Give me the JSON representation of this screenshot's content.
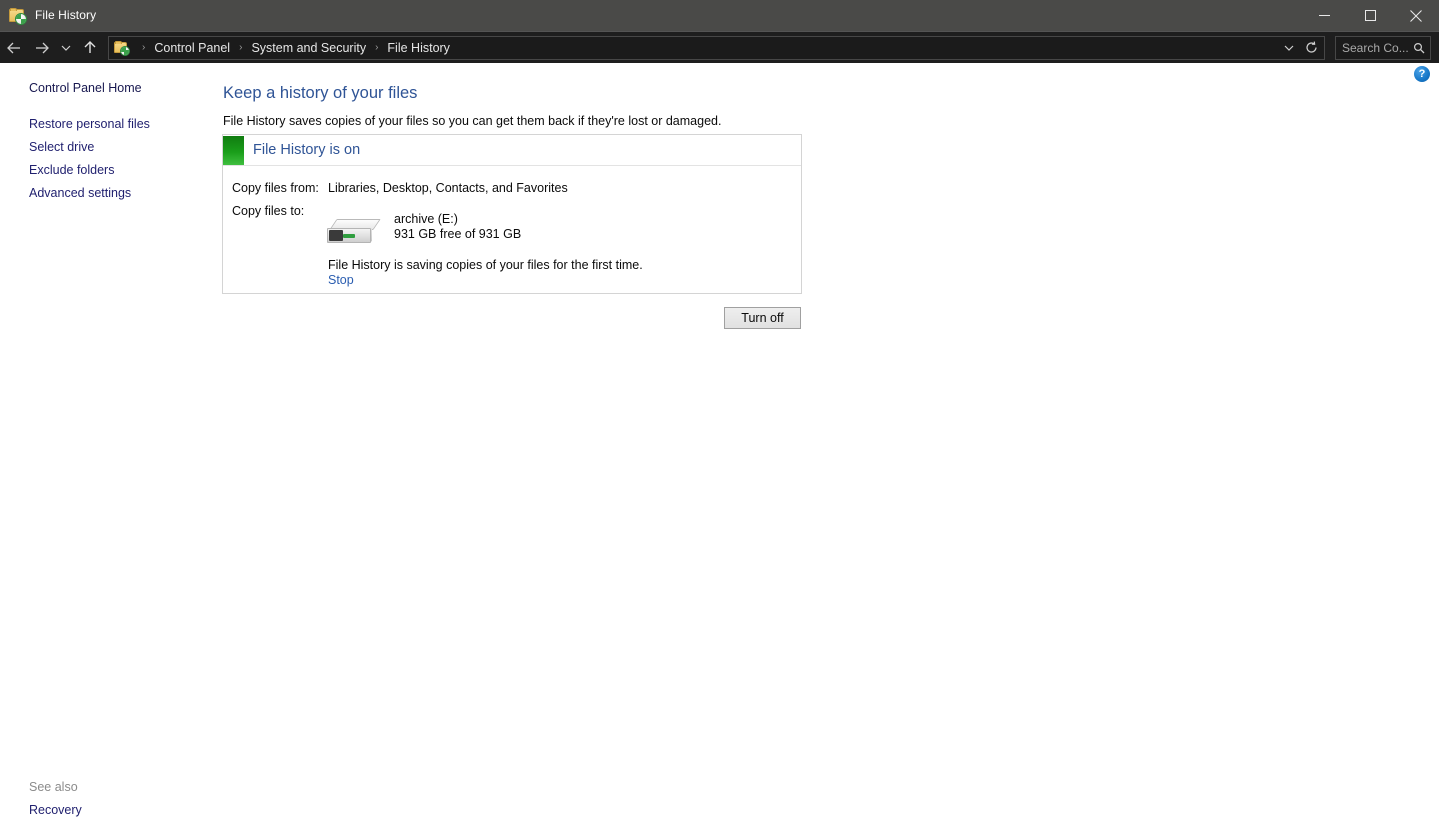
{
  "window": {
    "title": "File History",
    "icon": "file-history-icon",
    "controls": {
      "minimize": "minimize",
      "maximize": "maximize",
      "close": "close"
    }
  },
  "addressbar": {
    "back": "back",
    "forward": "forward",
    "recent": "recent-locations",
    "up": "up-one-level",
    "breadcrumbs": [
      {
        "label": "Control Panel"
      },
      {
        "label": "System and Security"
      },
      {
        "label": "File History"
      }
    ],
    "separator": "›",
    "dropdown": "previous-locations",
    "refresh": "refresh",
    "search": {
      "placeholder": "Search Co...",
      "value": ""
    }
  },
  "sidebar": {
    "home": "Control Panel Home",
    "items": [
      {
        "label": "Restore personal files"
      },
      {
        "label": "Select drive"
      },
      {
        "label": "Exclude folders"
      },
      {
        "label": "Advanced settings"
      }
    ],
    "see_also_heading": "See also",
    "see_also_items": [
      {
        "label": "Recovery"
      }
    ]
  },
  "main": {
    "title": "Keep a history of your files",
    "subtitle": "File History saves copies of your files so you can get them back if they're lost or damaged.",
    "status": {
      "headline": "File History is on",
      "chip_color": "#1a9e1a"
    },
    "copy_from": {
      "label": "Copy files from:",
      "value": "Libraries, Desktop, Contacts, and Favorites"
    },
    "copy_to": {
      "label": "Copy files to:",
      "drive_name": "archive (E:)",
      "drive_space": "931 GB free of 931 GB",
      "drive_icon": "external-drive-icon"
    },
    "progress_text": "File History is saving copies of your files for the first time.",
    "stop_link": "Stop",
    "turn_off_button": "Turn off",
    "help_button": "?"
  },
  "colors": {
    "titlebar": "#4a4a48",
    "addressbar": "#1e1e1e",
    "accent_blue": "#2f5496",
    "link_blue": "#1f1f6e",
    "status_green": "#1a9e1a"
  }
}
